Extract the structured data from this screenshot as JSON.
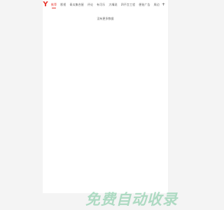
{
  "app": {
    "logo_char": "Y",
    "accent_color": "#e8352e"
  },
  "nav": {
    "items": [
      {
        "label": "推荐",
        "active": true
      },
      {
        "label": "影视",
        "active": false
      },
      {
        "label": "青瓜集合屋",
        "active": false
      },
      {
        "label": "评论",
        "active": false
      },
      {
        "label": "有可乐",
        "active": false
      },
      {
        "label": "大嘴说",
        "active": false
      },
      {
        "label": "四不言工程",
        "active": false
      },
      {
        "label": "便秘广告",
        "active": false
      },
      {
        "label": "周边",
        "active": false
      }
    ],
    "plus_label": "+"
  },
  "content": {
    "empty_text": "没有更多数据"
  },
  "watermark": {
    "text": "免费自动收录"
  }
}
